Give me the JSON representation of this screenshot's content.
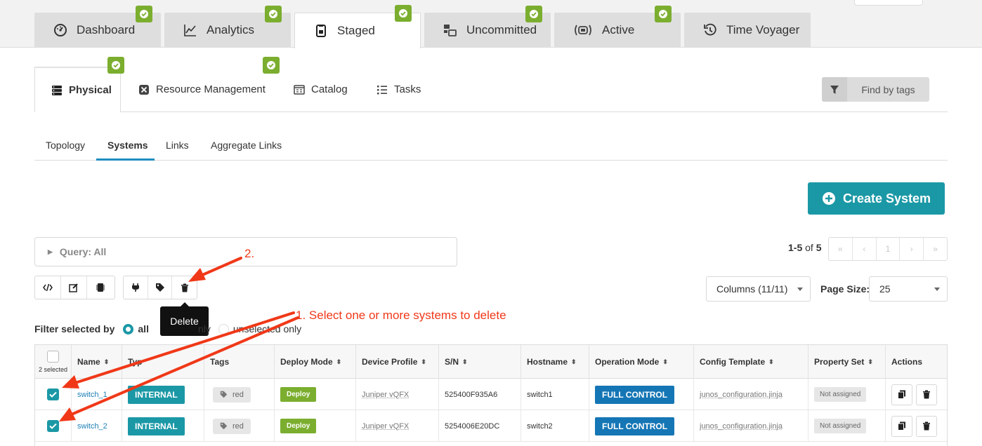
{
  "top_tabs": [
    {
      "label": "Dashboard",
      "icon": "gauge-icon",
      "badge": true
    },
    {
      "label": "Analytics",
      "icon": "line-chart-icon",
      "badge": true
    },
    {
      "label": "Staged",
      "icon": "staged-icon",
      "badge": true,
      "active": true
    },
    {
      "label": "Uncommitted",
      "icon": "uncommitted-icon",
      "badge": true
    },
    {
      "label": "Active",
      "icon": "active-broadcast-icon",
      "badge": true
    },
    {
      "label": "Time Voyager",
      "icon": "history-icon",
      "badge": false
    }
  ],
  "sub_tabs": [
    {
      "label": "Physical",
      "icon": "server-stack-icon",
      "badge": true,
      "active": true
    },
    {
      "label": "Resource Management",
      "icon": "resource-icon",
      "badge": true
    },
    {
      "label": "Catalog",
      "icon": "catalog-icon",
      "badge": false
    },
    {
      "label": "Tasks",
      "icon": "list-icon",
      "badge": false
    }
  ],
  "find_by_tags": "Find by tags",
  "view_tabs": [
    {
      "label": "Topology"
    },
    {
      "label": "Systems",
      "active": true
    },
    {
      "label": "Links"
    },
    {
      "label": "Aggregate Links"
    }
  ],
  "create_button": "Create System",
  "query": "Query: All",
  "pagination": {
    "range": "1-5",
    "of_text": "of",
    "total": "5",
    "current_page": "1",
    "buttons": [
      "«",
      "‹",
      "1",
      "›",
      "»"
    ]
  },
  "columns_select": "Columns (11/11)",
  "page_size_label": "Page Size:",
  "page_size_value": "25",
  "tooltip": "Delete",
  "filter": {
    "label": "Filter selected by",
    "options": [
      "all",
      "selected only",
      "unselected only"
    ],
    "visible_options": [
      "all",
      "nly",
      "unselected only"
    ],
    "selected": "all"
  },
  "table": {
    "selected_count": "2 selected",
    "headers": [
      "Name",
      "Type",
      "Tags",
      "Deploy Mode",
      "Device Profile",
      "S/N",
      "Hostname",
      "Operation Mode",
      "Config Template",
      "Property Set",
      "Actions"
    ],
    "header_visible": {
      "type": "Typ"
    },
    "rows": [
      {
        "name": "switch_1",
        "type": "INTERNAL",
        "tag": "red",
        "deploy_mode": "Deploy",
        "device_profile": "Juniper vQFX",
        "sn": "525400F935A6",
        "hostname": "switch1",
        "operation_mode": "FULL CONTROL",
        "config_template": "junos_configuration.jinja",
        "property_set": "Not assigned",
        "checked": true
      },
      {
        "name": "switch_2",
        "type": "INTERNAL",
        "tag": "red",
        "deploy_mode": "Deploy",
        "device_profile": "Juniper vQFX",
        "sn": "5254006E20DC",
        "hostname": "switch2",
        "operation_mode": "FULL CONTROL",
        "config_template": "junos_configuration.jinja",
        "property_set": "Not assigned",
        "checked": true
      }
    ]
  },
  "annotations": {
    "step1": "1. Select one or more systems to delete",
    "step2": "2."
  },
  "colors": {
    "accent": "#1b98a6",
    "badge_green": "#7bae2f",
    "link_blue": "#1e7fb5",
    "full_control": "#1576b5",
    "annotation_red": "#f03818"
  }
}
